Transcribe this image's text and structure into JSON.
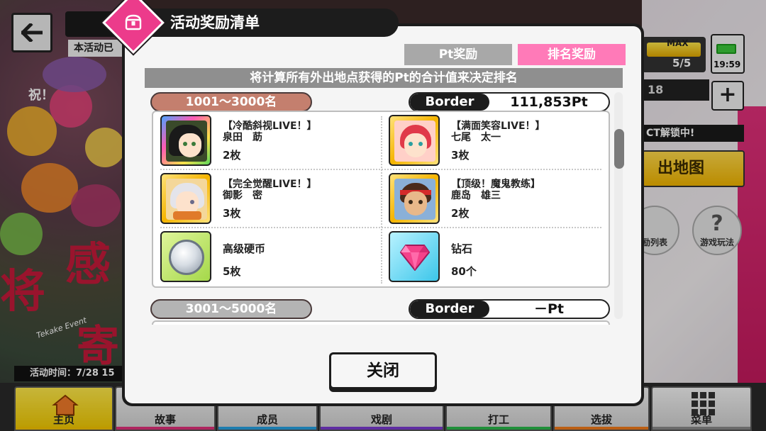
{
  "background": {
    "notice": "本活动已",
    "event_time": "活动时间：7/28 15",
    "big_chars": [
      "祝！",
      "将",
      "感",
      "寄"
    ],
    "event_script": "Tekake Event",
    "hud": {
      "max_label": "MAX",
      "count": "5/5",
      "time": "19:59",
      "level_partial": "18",
      "plus": "+",
      "unlock": "CT解锁中!",
      "map": "出地图",
      "list_btn": "励列表",
      "help_btn": "游戏玩法"
    },
    "nav": [
      {
        "label": "主页",
        "color": "#f5c400"
      },
      {
        "label": "故事",
        "color": "#e0307a"
      },
      {
        "label": "成员",
        "color": "#26a0e0"
      },
      {
        "label": "戏剧",
        "color": "#7a3ad0"
      },
      {
        "label": "打工",
        "color": "#2ab84a"
      },
      {
        "label": "选拔",
        "color": "#f07a1a"
      },
      {
        "label": "菜单",
        "color": "#888888"
      }
    ]
  },
  "modal": {
    "title": "活动奖励清单",
    "tabs": {
      "pt": "Pt奖励",
      "rank": "排名奖励"
    },
    "description": "将计算所有外出地点获得的Pt的合计值来决定排名",
    "sections": [
      {
        "rank_range": "1001～3000名",
        "border_label": "Border",
        "border_value": "111,853Pt",
        "rewards": [
          {
            "name": "【冷酷斜视LIVE！】",
            "member": "泉田　莇",
            "qty": "2枚"
          },
          {
            "name": "【满面笑容LIVE！】",
            "member": "七尾　太一",
            "qty": "3枚"
          },
          {
            "name": "【完全觉醒LIVE！】",
            "member": "御影　密",
            "qty": "3枚"
          },
          {
            "name": "【顶级！魔鬼教练】",
            "member": "鹿岛　雄三",
            "qty": "2枚"
          },
          {
            "name": "高级硬币",
            "qty": "5枚"
          },
          {
            "name": "钻石",
            "qty": "80个"
          }
        ]
      },
      {
        "rank_range": "3001～5000名",
        "border_label": "Border",
        "border_value": "－Pt"
      }
    ],
    "close_label": "关闭"
  },
  "colors": {
    "accent_pink": "#ec3b8b",
    "tab_active": "#ff7ab8",
    "tab_inactive": "#a8a8a8",
    "rank_first": "#c47f6e",
    "rank_second": "#b4b4b4"
  },
  "icons": [
    "back-arrow-icon",
    "treasure-chest-icon",
    "battery-icon",
    "plus-icon",
    "help-icon",
    "gift-icon",
    "home-icon",
    "grid-menu-icon"
  ]
}
